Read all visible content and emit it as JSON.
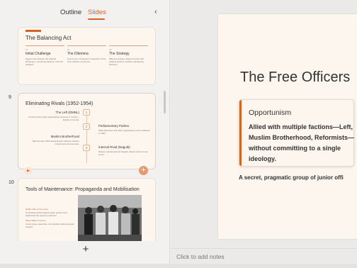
{
  "panel": {
    "tab_outline": "Outline",
    "tab_slides": "Slides",
    "collapse_glyph": "‹",
    "add_slide_glyph": "+"
  },
  "slides": [
    {
      "title": "The Balancing Act",
      "columns": [
        {
          "num": "01",
          "heading": "Initial Challenge",
          "text": "Egypt under Nasser, the political landscape, competing factions, and civil disputes."
        },
        {
          "num": "02",
          "heading": "The Dilemma",
          "text": "How to be a competent \"vanguard\" of the Free Officers movement."
        },
        {
          "num": "03",
          "heading": "The Strategy",
          "text": "Balance between Egypt and the rival political factions towards maintaining authority."
        }
      ]
    },
    {
      "number": "9",
      "title": "Eliminating Rivals (1952-1954)",
      "left_items": [
        {
          "heading": "The Left (DMNL)",
          "text": "Crushed when split organisations seemed in control—leaders removed."
        },
        {
          "heading": "Muslim Brotherhood",
          "text": "Banned after 1954 assassination attempt; leaders imprisoned and executed."
        }
      ],
      "right_items": [
        {
          "heading": "Parliamentary Parties",
          "text": "Wafd dissolved and party organisations were outlawed in 1953."
        },
        {
          "heading": "Internal Rival (Naguib)",
          "text": "Nasser outmanoeuvred Naguib, placed under house arrest."
        }
      ],
      "nodes": [
        "1",
        "2",
        "3"
      ],
      "play_glyph": "▶",
      "add_glyph": "+"
    },
    {
      "number": "10",
      "title": "Tools of Maintenance: Propaganda and Mobilisation",
      "text_blocks": [
        "Radio Cairo & the press",
        "Controlled media shaped public opinion and legitimised the regime's authority.",
        "Mass rallies & events",
        "Ceremonies, speeches, and parades rallied popular support."
      ]
    }
  ],
  "main_slide": {
    "title": "The Free Officers",
    "callout_heading": "Opportunism",
    "callout_body": "Allied with multiple factions—Left, Muslim Brotherhood, Reformists—without committing to a single ideology.",
    "subline": "A secret, pragmatic group of junior offi"
  },
  "notes_placeholder": "Click to add notes",
  "colors": {
    "accent": "#d4632a",
    "slide_bg": "#fdf6ee",
    "panel_bg": "#f2f1f0"
  }
}
